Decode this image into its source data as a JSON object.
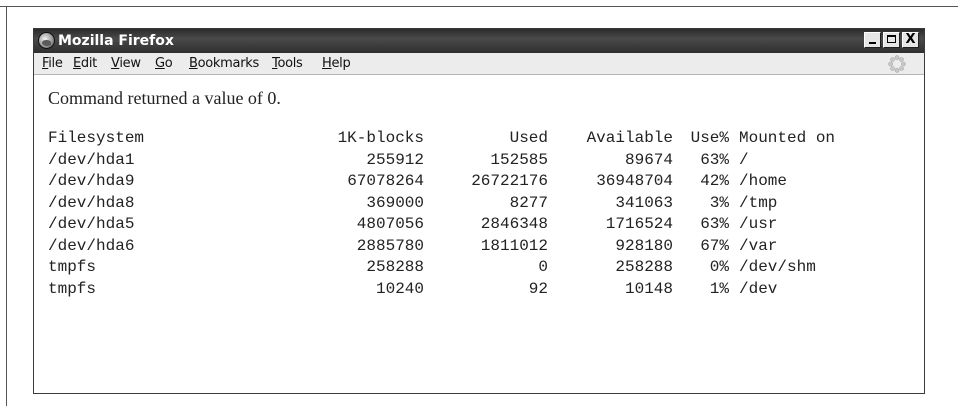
{
  "window": {
    "title": "Mozilla Firefox",
    "icon": "firefox-icon",
    "controls": {
      "minimize": "minimize-icon",
      "maximize": "maximize-icon",
      "close": "close-icon"
    },
    "close_glyph": "X"
  },
  "menubar": {
    "items": [
      {
        "label": "File",
        "mnemonic": "F",
        "rest": "ile"
      },
      {
        "label": "Edit",
        "mnemonic": "E",
        "rest": "dit"
      },
      {
        "label": "View",
        "mnemonic": "V",
        "rest": "iew"
      },
      {
        "label": "Go",
        "mnemonic": "G",
        "rest": "o"
      },
      {
        "label": "Bookmarks",
        "mnemonic": "B",
        "rest": "ookmarks"
      },
      {
        "label": "Tools",
        "mnemonic": "T",
        "rest": "ools"
      },
      {
        "label": "Help",
        "mnemonic": "H",
        "rest": "elp"
      }
    ],
    "activity_icon": "throbber-icon"
  },
  "content": {
    "message": "Command returned a value of 0.",
    "table": {
      "headers": {
        "filesystem": "Filesystem",
        "blocks": "1K-blocks",
        "used": "Used",
        "available": "Available",
        "use_pct": "Use%",
        "mounted": "Mounted on"
      },
      "rows": [
        {
          "filesystem": "/dev/hda1",
          "blocks": "255912",
          "used": "152585",
          "available": "89674",
          "use_pct": "63%",
          "mounted": "/"
        },
        {
          "filesystem": "/dev/hda9",
          "blocks": "67078264",
          "used": "26722176",
          "available": "36948704",
          "use_pct": "42%",
          "mounted": "/home"
        },
        {
          "filesystem": "/dev/hda8",
          "blocks": "369000",
          "used": "8277",
          "available": "341063",
          "use_pct": "3%",
          "mounted": "/tmp"
        },
        {
          "filesystem": "/dev/hda5",
          "blocks": "4807056",
          "used": "2846348",
          "available": "1716524",
          "use_pct": "63%",
          "mounted": "/usr"
        },
        {
          "filesystem": "/dev/hda6",
          "blocks": "2885780",
          "used": "1811012",
          "available": "928180",
          "use_pct": "67%",
          "mounted": "/var"
        },
        {
          "filesystem": "tmpfs",
          "blocks": "258288",
          "used": "0",
          "available": "258288",
          "use_pct": "0%",
          "mounted": "/dev/shm"
        },
        {
          "filesystem": "tmpfs",
          "blocks": "10240",
          "used": "92",
          "available": "10148",
          "use_pct": "1%",
          "mounted": "/dev"
        }
      ]
    }
  }
}
